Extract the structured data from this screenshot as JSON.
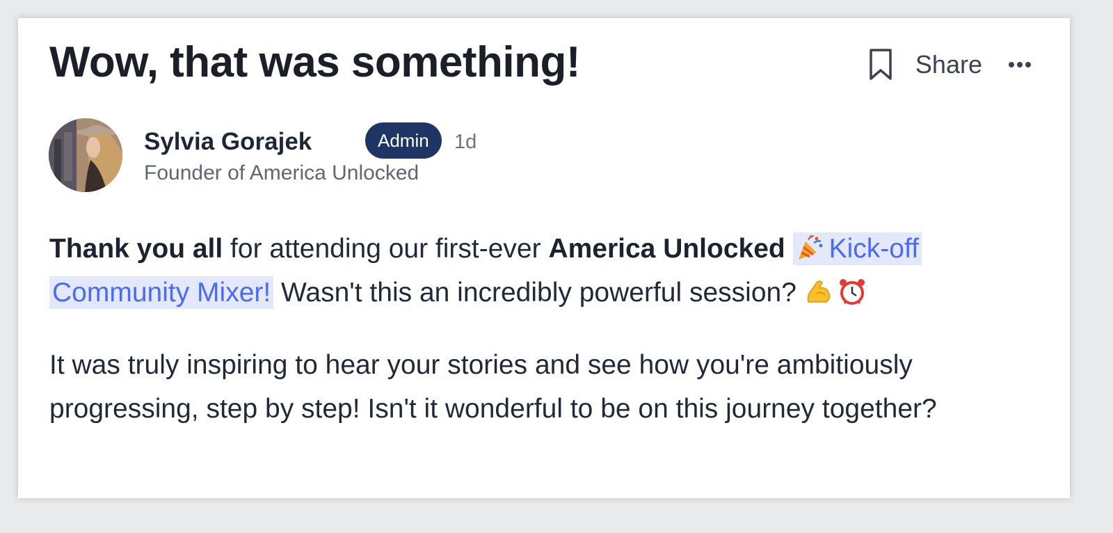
{
  "post": {
    "title": "Wow, that was something!",
    "share_label": "Share",
    "more_icon": "more-horizontal-icon",
    "bookmark_icon": "bookmark-icon"
  },
  "author": {
    "name": "Sylvia Gorajek",
    "badge": "Admin",
    "time": "1d",
    "subtitle": "Founder of America Unlocked"
  },
  "body": {
    "p1": {
      "bold1": "Thank you all",
      "text1": " for attending our first-ever ",
      "bold2": "America Unlocked",
      "link_emoji": "party-popper-icon",
      "link_text": "Kick-off Community Mixer!",
      "text2": " Wasn't this an incredibly powerful session? ",
      "emoji1": "flexed-biceps-icon",
      "emoji2": "alarm-clock-icon"
    },
    "p2": "It was truly inspiring to hear your stories and see how you're ambitiously progressing, step by step! Isn't it wonderful to be on this journey together?"
  },
  "colors": {
    "badge_bg": "#1f3566",
    "link": "#4a6cf0",
    "link_bg": "#e3e8fc"
  }
}
